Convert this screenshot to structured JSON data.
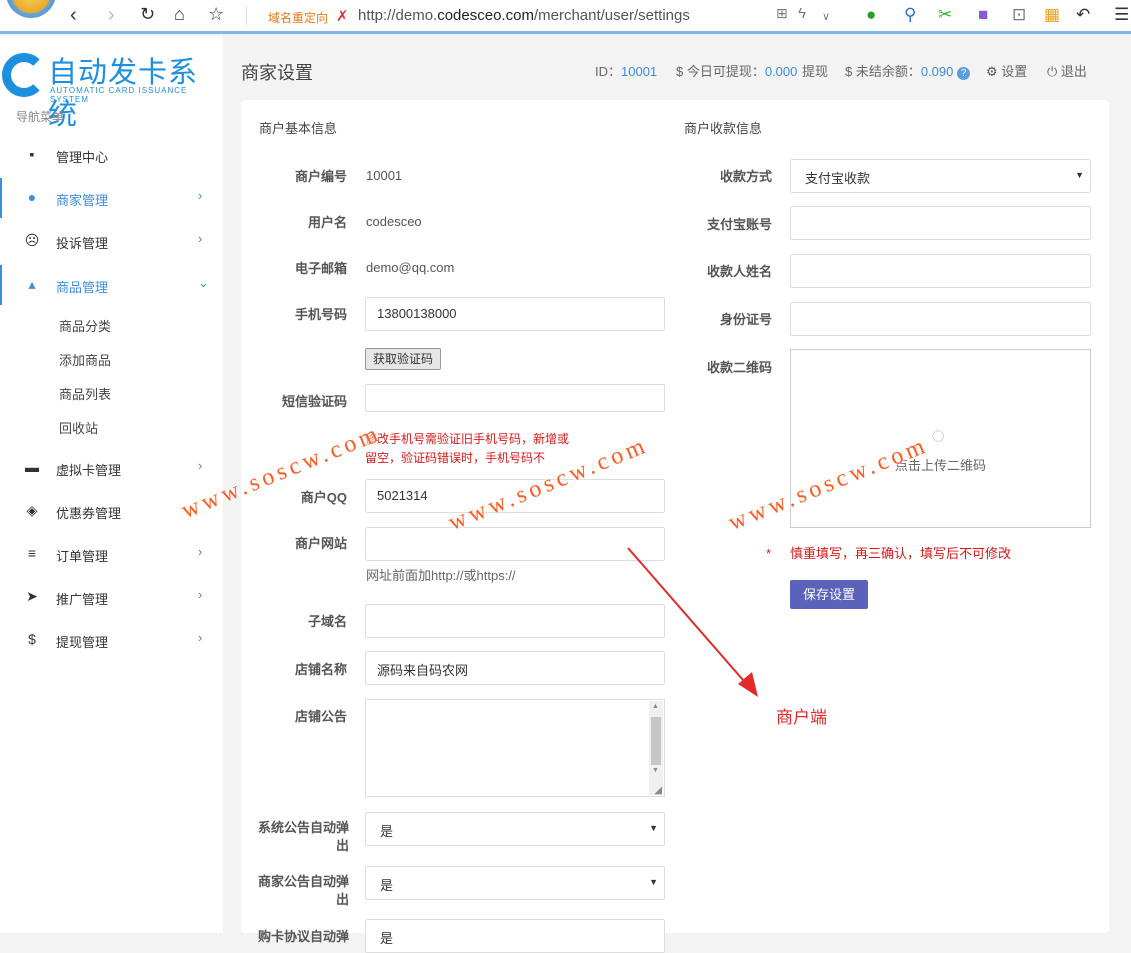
{
  "browser": {
    "redirect_label": "域名重定向",
    "url_prefix": "http://demo.",
    "url_domain": "codesceo.com",
    "url_path": "/merchant/user/settings"
  },
  "sidebar": {
    "brand_title": "自动发卡系统",
    "brand_subtitle": "AUTOMATIC CARD ISSUANCE SYSTEM",
    "menu_label": "导航菜单",
    "items": [
      {
        "label": "管理中心",
        "icon": "dashboard-icon"
      },
      {
        "label": "商家管理",
        "icon": "user-icon"
      },
      {
        "label": "投诉管理",
        "icon": "frown-icon"
      },
      {
        "label": "商品管理",
        "icon": "shopping-bag-icon"
      },
      {
        "label": "虚拟卡管理",
        "icon": "card-icon"
      },
      {
        "label": "优惠券管理",
        "icon": "tag-icon"
      },
      {
        "label": "订单管理",
        "icon": "list-icon"
      },
      {
        "label": "推广管理",
        "icon": "send-icon"
      },
      {
        "label": "提现管理",
        "icon": "dollar-icon"
      }
    ],
    "submenu": [
      "商品分类",
      "添加商品",
      "商品列表",
      "回收站"
    ]
  },
  "header": {
    "page_title": "商家设置",
    "id_label": "ID：",
    "id_value": "10001",
    "withdraw_label": "$ 今日可提现：",
    "withdraw_value": "0.000",
    "withdraw_link": "提现",
    "unsettled_label": "$ 未结余额：",
    "unsettled_value": "0.090",
    "help_glyph": "?",
    "settings_label": "设置",
    "logout_label": "退出"
  },
  "basic": {
    "section_title": "商户基本信息",
    "merchant_no_label": "商户编号",
    "merchant_no": "10001",
    "username_label": "用户名",
    "username": "codesceo",
    "email_label": "电子邮箱",
    "email": "demo@qq.com",
    "phone_label": "手机号码",
    "phone": "13800138000",
    "get_code_button": "获取验证码",
    "sms_label": "短信验证码",
    "sms_hint_line1": "修改手机号需验证旧手机号码，新增或",
    "sms_hint_line2": "留空，验证码错误时，手机号码不",
    "qq_label": "商户QQ",
    "qq": "5021314",
    "website_label": "商户网站",
    "website_hint": "网址前面加http://或https://",
    "subdomain_label": "子域名",
    "shop_name_label": "店铺名称",
    "shop_name": "源码来自码农网",
    "shop_notice_label": "店铺公告",
    "sys_popup_label_1": "系统公告自动弹",
    "sys_popup_label_2": "出",
    "sys_popup_value": "是",
    "merchant_popup_label_1": "商家公告自动弹",
    "merchant_popup_label_2": "出",
    "merchant_popup_value": "是",
    "next_label": "购卡协议自动弹",
    "next_value": "是"
  },
  "payment": {
    "section_title": "商户收款信息",
    "method_label": "收款方式",
    "method_value": "支付宝收款",
    "account_label": "支付宝账号",
    "payee_label": "收款人姓名",
    "id_card_label": "身份证号",
    "qrcode_label": "收款二维码",
    "upload_text": "点击上传二维码",
    "warning_star": "*",
    "warning": "慎重填写，再三确认，填写后不可修改",
    "save_button": "保存设置"
  },
  "watermark": "www.soscw.com",
  "annotation": "商户端",
  "colors": {
    "accent": "#3c8dde",
    "save": "#5a63b9",
    "warning": "#d81818",
    "watermark": "#ff5a1f"
  }
}
